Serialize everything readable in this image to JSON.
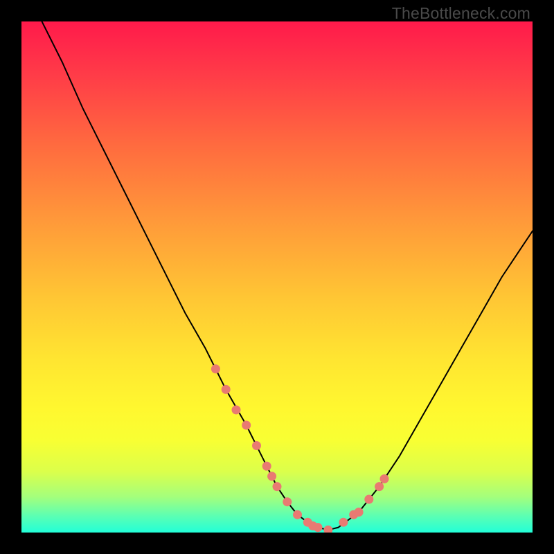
{
  "watermark": "TheBottleneck.com",
  "chart_data": {
    "type": "line",
    "title": "",
    "xlabel": "",
    "ylabel": "",
    "xlim": [
      0,
      100
    ],
    "ylim": [
      0,
      100
    ],
    "grid": false,
    "background_gradient": {
      "top_color": "#ff1a4b",
      "bottom_color": "#22ffd8",
      "description": "vertical red-to-green gradient indicating bottleneck severity"
    },
    "series": [
      {
        "name": "bottleneck-curve",
        "color": "#000000",
        "x": [
          4,
          8,
          12,
          16,
          20,
          24,
          28,
          32,
          36,
          40,
          44,
          48,
          50,
          52,
          54,
          56,
          58,
          60,
          62,
          66,
          70,
          74,
          78,
          82,
          86,
          90,
          94,
          98,
          100
        ],
        "y": [
          100,
          92,
          83,
          75,
          67,
          59,
          51,
          43,
          36,
          28,
          21,
          13,
          9,
          6,
          3.5,
          2,
          1,
          0.5,
          1,
          4,
          9,
          15,
          22,
          29,
          36,
          43,
          50,
          56,
          59
        ]
      },
      {
        "name": "highlight-dots",
        "color": "#e97a72",
        "style": "dots",
        "x": [
          38,
          40,
          42,
          44,
          46,
          48,
          49,
          50,
          52,
          54,
          56,
          57,
          58,
          60,
          63,
          65,
          66,
          68,
          70,
          71
        ],
        "y": [
          32,
          28,
          24,
          21,
          17,
          13,
          11,
          9,
          6,
          3.5,
          2,
          1.3,
          1,
          0.5,
          2,
          3.5,
          4,
          6.5,
          9,
          10.5
        ]
      }
    ]
  }
}
